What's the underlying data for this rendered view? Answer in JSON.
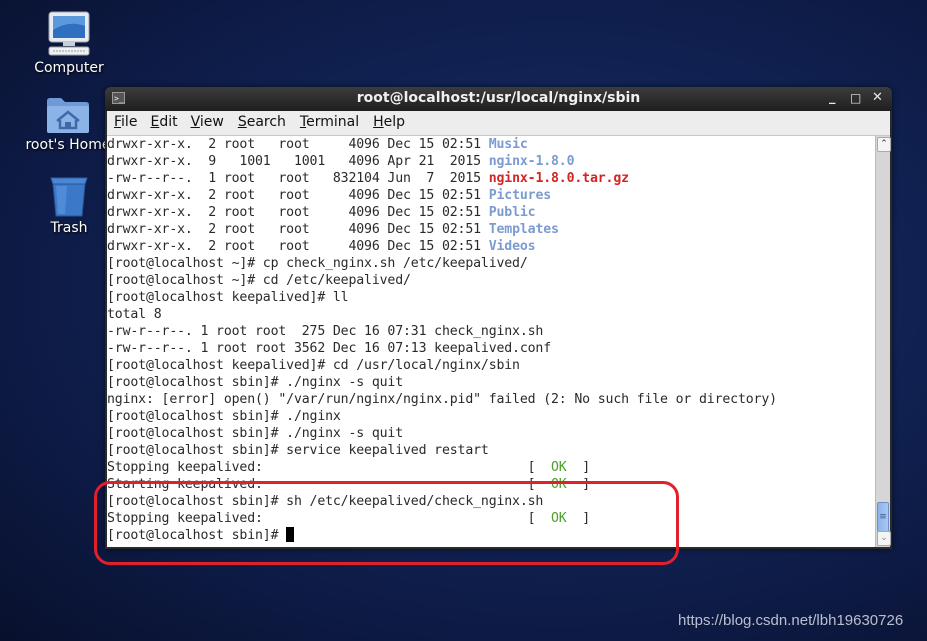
{
  "desktop": {
    "icons": [
      {
        "label": "Computer",
        "icon": "computer-icon"
      },
      {
        "label": "root's Home",
        "icon": "home-folder-icon"
      },
      {
        "label": "Trash",
        "icon": "trash-icon"
      }
    ]
  },
  "window": {
    "title": "root@localhost:/usr/local/nginx/sbin",
    "icon": "terminal-icon",
    "controls": {
      "minimize": "_",
      "maximize": "□",
      "close": "✕"
    },
    "menu": [
      {
        "accel": "F",
        "rest": "ile"
      },
      {
        "accel": "E",
        "rest": "dit"
      },
      {
        "accel": "V",
        "rest": "iew"
      },
      {
        "accel": "S",
        "rest": "earch"
      },
      {
        "accel": "T",
        "rest": "erminal"
      },
      {
        "accel": "H",
        "rest": "elp"
      }
    ]
  },
  "terminal": {
    "listing": [
      {
        "meta": "drwxr-xr-x.  2 root   root     4096 Dec 15 02:51 ",
        "name": "Music",
        "type": "dir"
      },
      {
        "meta": "drwxr-xr-x.  9   1001   1001   4096 Apr 21  2015 ",
        "name": "nginx-1.8.0",
        "type": "dir"
      },
      {
        "meta": "-rw-r--r--.  1 root   root   832104 Jun  7  2015 ",
        "name": "nginx-1.8.0.tar.gz",
        "type": "arch"
      },
      {
        "meta": "drwxr-xr-x.  2 root   root     4096 Dec 15 02:51 ",
        "name": "Pictures",
        "type": "dir"
      },
      {
        "meta": "drwxr-xr-x.  2 root   root     4096 Dec 15 02:51 ",
        "name": "Public",
        "type": "dir"
      },
      {
        "meta": "drwxr-xr-x.  2 root   root     4096 Dec 15 02:51 ",
        "name": "Templates",
        "type": "dir"
      },
      {
        "meta": "drwxr-xr-x.  2 root   root     4096 Dec 15 02:51 ",
        "name": "Videos",
        "type": "dir"
      }
    ],
    "lines": [
      "[root@localhost ~]# cp check_nginx.sh /etc/keepalived/",
      "[root@localhost ~]# cd /etc/keepalived/",
      "[root@localhost keepalived]# ll",
      "total 8",
      "-rw-r--r--. 1 root root  275 Dec 16 07:31 check_nginx.sh",
      "-rw-r--r--. 1 root root 3562 Dec 16 07:13 keepalived.conf",
      "[root@localhost keepalived]# cd /usr/local/nginx/sbin",
      "[root@localhost sbin]# ./nginx -s quit",
      "nginx: [error] open() \"/var/run/nginx/nginx.pid\" failed (2: No such file or directory)",
      "[root@localhost sbin]# ./nginx",
      "[root@localhost sbin]# ./nginx -s quit",
      "[root@localhost sbin]# service keepalived restart"
    ],
    "status_lines": [
      {
        "text": "Stopping keepalived:                                  ",
        "open": "[  ",
        "ok": "OK",
        "close": "  ]"
      },
      {
        "text": "Starting keepalived:                                  ",
        "open": "[  ",
        "ok": "OK",
        "close": "  ]"
      }
    ],
    "after": "[root@localhost sbin]# sh /etc/keepalived/check_nginx.sh",
    "final_status": {
      "text": "Stopping keepalived:                                  ",
      "open": "[  ",
      "ok": "OK",
      "close": "  ]"
    },
    "prompt": "[root@localhost sbin]# "
  },
  "scrollbar": {
    "up": "⌃",
    "down": "⌄",
    "thumb_grip": "≡",
    "position": "bottom"
  },
  "watermark": "https://blog.csdn.net/lbh19630726"
}
